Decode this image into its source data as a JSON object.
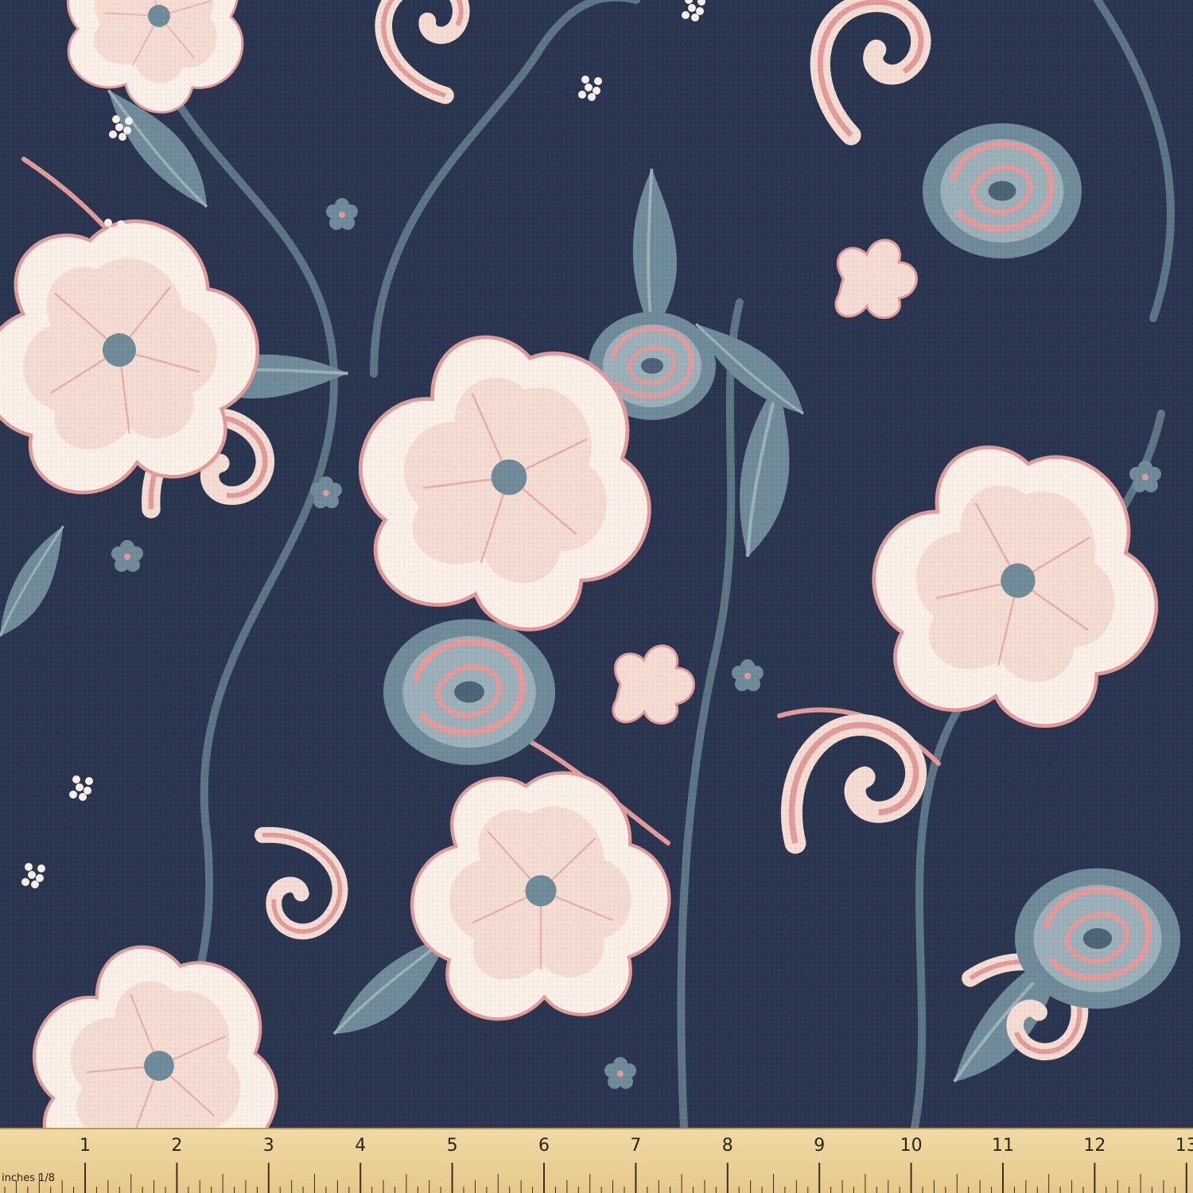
{
  "image": {
    "subject": "floral-fabric-swatch",
    "palette": {
      "background": "#2a3550",
      "blush": "#f4dcd2",
      "cream": "#fbf0e8",
      "pink": "#e39a9b",
      "slate": "#6f8b99",
      "slate_light": "#9bb0b9",
      "ruler": "#ecd29a"
    }
  },
  "ruler": {
    "unit_label": "inches 1/8",
    "numbers": [
      "1",
      "2",
      "3",
      "4",
      "5",
      "6",
      "7",
      "8",
      "9",
      "10",
      "11",
      "12",
      "13"
    ]
  }
}
